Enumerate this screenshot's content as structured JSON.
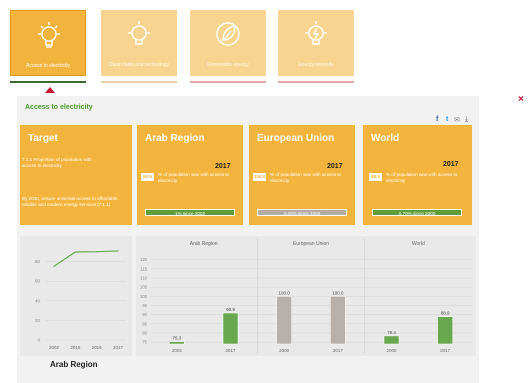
{
  "tabs": [
    {
      "label": "Access to electricity",
      "icon": "lightbulb-icon",
      "active": true
    },
    {
      "label": "Clean fuels and technology",
      "icon": "lightbulb-icon",
      "active": false
    },
    {
      "label": "Renewable energy",
      "icon": "leaf-icon",
      "active": false
    },
    {
      "label": "Energy intensity",
      "icon": "lightning-bulb-icon",
      "active": false
    }
  ],
  "panel": {
    "title": "Access to electricity"
  },
  "close_label": "×",
  "share": {
    "facebook": "f",
    "twitter": "t",
    "email": "✉",
    "download": "⤓"
  },
  "target_card": {
    "title": "Target",
    "indicator": "7.1.1 Proportion of population with access to electricity",
    "goal": "By 2030, ensure universal access to affordable, reliable and modern energy services [7.1.1]"
  },
  "region_cards": [
    {
      "title": "Arab Region",
      "year": "2017",
      "value": "90.9",
      "desc": "% of population was with access to electricity",
      "trend": "1%   since   2002",
      "trend_color": "#5f9d3b"
    },
    {
      "title": "European Union",
      "year": "2017",
      "value": "100.0",
      "desc": "% of population was with access to electricity",
      "trend": "0.00%   since   2000",
      "trend_color": "#b3aca4"
    },
    {
      "title": "World",
      "year": "2017",
      "value": "88.9",
      "desc": "% of population was with access to electricity",
      "trend": "0.70%   since   2000",
      "trend_color": "#5f9d3b"
    }
  ],
  "footer_title": "Arab Region",
  "colors": {
    "accent": "#f2b43c",
    "green": "#6aa84f",
    "grey_bar": "#b8b1ab",
    "red": "#c8102e"
  },
  "chart_data": [
    {
      "type": "line",
      "x": [
        "2002",
        "2015",
        "2016",
        "2017"
      ],
      "values": [
        75.3,
        89.8,
        90.1,
        90.9
      ],
      "yticks": [
        0,
        20,
        40,
        60,
        80
      ],
      "ylim": [
        0,
        100
      ],
      "grid": true
    },
    {
      "type": "bar",
      "panels": [
        {
          "title": "Arab Region",
          "categories": [
            "2002",
            "2017"
          ],
          "values": [
            75.3,
            90.9
          ],
          "labels": [
            "75.3",
            "90.9"
          ],
          "color": "#6aa84f"
        },
        {
          "title": "European Union",
          "categories": [
            "2000",
            "2017"
          ],
          "values": [
            100.0,
            100.0
          ],
          "labels": [
            "100.0",
            "100.0"
          ],
          "color": "#b8b1ab"
        },
        {
          "title": "World",
          "categories": [
            "2000",
            "2017"
          ],
          "values": [
            78.4,
            88.9
          ],
          "labels": [
            "78.4",
            "88.9"
          ],
          "color": "#6aa84f"
        }
      ],
      "yticks": [
        75,
        80,
        85,
        90,
        95,
        100,
        105,
        110,
        115,
        120
      ],
      "ylim": [
        74,
        122
      ],
      "grid": true
    }
  ]
}
